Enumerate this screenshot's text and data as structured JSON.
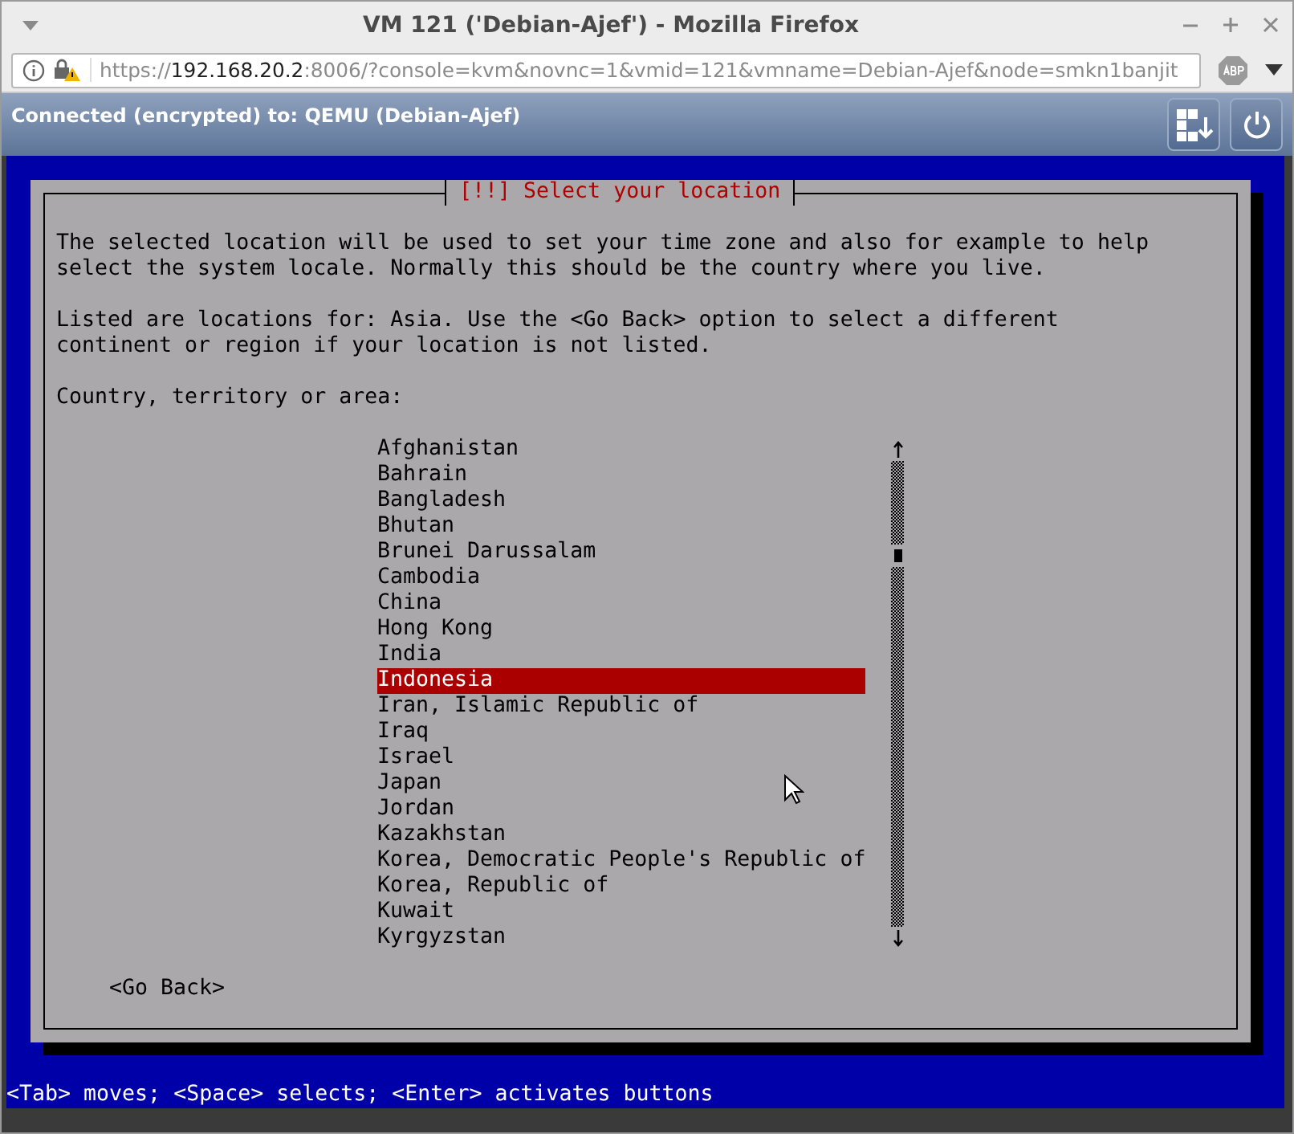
{
  "window": {
    "title": "VM 121 ('Debian-Ajef') - Mozilla Firefox"
  },
  "address_bar": {
    "scheme": "https://",
    "host": "192.168.20.2",
    "rest": ":8006/?console=kvm&novnc=1&vmid=121&vmname=Debian-Ajef&node=smkn1banjit"
  },
  "vnc_bar": {
    "status": "Connected (encrypted) to: QEMU (Debian-Ajef)"
  },
  "dialog": {
    "title": "[!!] Select your location",
    "paragraphs": [
      "The selected location will be used to set your time zone and also for example to help select the system locale. Normally this should be the country where you live.",
      "Listed are locations for: Asia. Use the <Go Back> option to select a different continent or region if your location is not listed."
    ],
    "prompt": "Country, territory or area:",
    "items": [
      {
        "label": "Afghanistan",
        "selected": false
      },
      {
        "label": "Bahrain",
        "selected": false
      },
      {
        "label": "Bangladesh",
        "selected": false
      },
      {
        "label": "Bhutan",
        "selected": false
      },
      {
        "label": "Brunei Darussalam",
        "selected": false
      },
      {
        "label": "Cambodia",
        "selected": false
      },
      {
        "label": "China",
        "selected": false
      },
      {
        "label": "Hong Kong",
        "selected": false
      },
      {
        "label": "India",
        "selected": false
      },
      {
        "label": "Indonesia",
        "selected": true
      },
      {
        "label": "Iran, Islamic Republic of",
        "selected": false
      },
      {
        "label": "Iraq",
        "selected": false
      },
      {
        "label": "Israel",
        "selected": false
      },
      {
        "label": "Japan",
        "selected": false
      },
      {
        "label": "Jordan",
        "selected": false
      },
      {
        "label": "Kazakhstan",
        "selected": false
      },
      {
        "label": "Korea, Democratic People's Republic of",
        "selected": false
      },
      {
        "label": "Korea, Republic of",
        "selected": false
      },
      {
        "label": "Kuwait",
        "selected": false
      },
      {
        "label": "Kyrgyzstan",
        "selected": false
      }
    ],
    "back_button": "<Go Back>"
  },
  "status_line": "<Tab> moves; <Space> selects; <Enter> activates buttons"
}
